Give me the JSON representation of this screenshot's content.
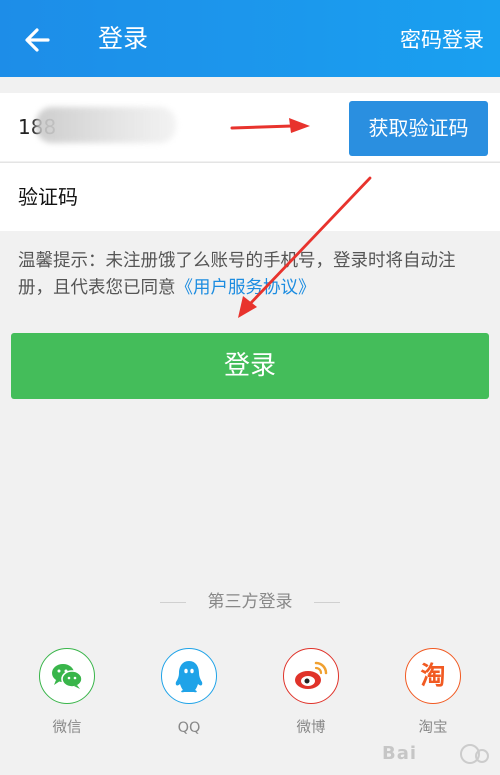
{
  "header": {
    "back_icon": "arrow-left-icon",
    "title": "登录",
    "password_login": "密码登录",
    "color_start": "#1d8de8",
    "color_end": "#1aa0f0"
  },
  "form": {
    "phone_value": "188",
    "get_code_button": "获取验证码",
    "code_placeholder": "验证码"
  },
  "tip": {
    "text": "温馨提示：未注册饿了么账号的手机号，登录时将自动注册，且代表您已同意",
    "agreement_link": "《用户服务协议》"
  },
  "login_button": "登录",
  "third_party": {
    "title": "第三方登录",
    "items": [
      {
        "name": "wechat",
        "label": "微信",
        "icon": "wechat-icon",
        "color": "#39b54a"
      },
      {
        "name": "qq",
        "label": "QQ",
        "icon": "qq-penguin-icon",
        "color": "#1fa3e8"
      },
      {
        "name": "weibo",
        "label": "微博",
        "icon": "weibo-icon",
        "color": "#e0332a"
      },
      {
        "name": "taobao",
        "label": "淘宝",
        "icon": "taobao-icon",
        "color": "#f15a22",
        "glyph": "淘"
      }
    ]
  },
  "annotations": {
    "arrow_color": "#e8332d"
  },
  "colors": {
    "accent_blue": "#2a8fe0",
    "login_green": "#44bd5a",
    "background": "#f1f1f1"
  }
}
